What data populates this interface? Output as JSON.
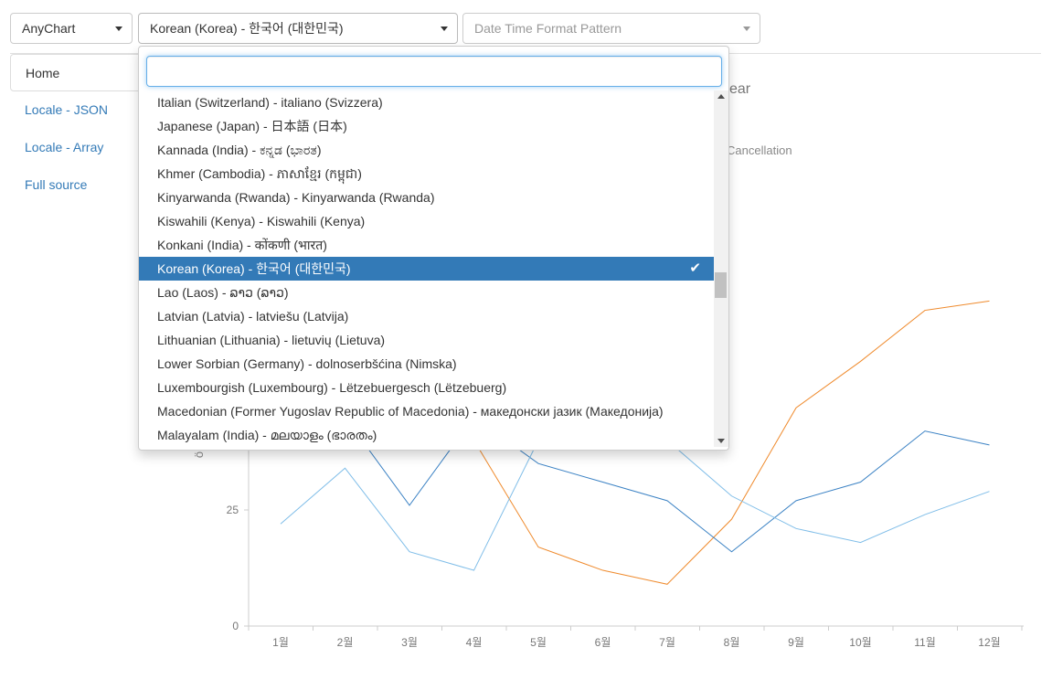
{
  "toolbar": {
    "library_select": "AnyChart",
    "locale_select": "Korean (Korea) - 한국어 (대한민국)",
    "format_placeholder": "Date Time Format Pattern"
  },
  "sidebar": {
    "items": [
      {
        "label": "Home",
        "active": true
      },
      {
        "label": "Locale - JSON"
      },
      {
        "label": "Locale - Array"
      },
      {
        "label": "Full source"
      }
    ]
  },
  "chart_fragments": {
    "title_tail": "ear",
    "legend_tail": "Cancellation",
    "ylabel_tail": "ö"
  },
  "dropdown": {
    "search_value": "",
    "items": [
      "Italian (Switzerland) - italiano (Svizzera)",
      "Japanese (Japan) - 日本語 (日本)",
      "Kannada (India) - ಕನ್ನಡ (ಭಾರತ)",
      "Khmer (Cambodia) - ភាសាខ្មែរ (កម្ពុជា)",
      "Kinyarwanda (Rwanda) - Kinyarwanda (Rwanda)",
      "Kiswahili (Kenya) - Kiswahili (Kenya)",
      "Konkani (India) - कोंकणी (भारत)",
      "Korean (Korea) - 한국어 (대한민국)",
      "Lao (Laos) - ລາວ (ລາວ)",
      "Latvian (Latvia) - latviešu (Latvija)",
      "Lithuanian (Lithuania) - lietuvių (Lietuva)",
      "Lower Sorbian (Germany) - dolnoserbšćina (Nimska)",
      "Luxembourgish (Luxembourg) - Lëtzebuergesch (Lëtzebuerg)",
      "Macedonian (Former Yugoslav Republic of Macedonia) - македонски јазик (Македонија)",
      "Malayalam (India) - മലയാളം (ഭാരതം)"
    ],
    "selected_index": 7,
    "check_icon": "check-icon"
  },
  "colors": {
    "accent": "#337ab7",
    "series_orange": "#ef8a2c",
    "series_blue": "#3b82c4",
    "series_lightblue": "#7fbde8"
  },
  "chart_data": {
    "type": "line",
    "categories": [
      "1월",
      "2월",
      "3월",
      "4월",
      "5월",
      "6월",
      "7월",
      "8월",
      "9월",
      "10월",
      "11월",
      "12월"
    ],
    "y_ticks": [
      0,
      25
    ],
    "ylim": [
      0,
      80
    ],
    "series": [
      {
        "color": "#ef8a2c",
        "values": [
          null,
          null,
          null,
          40,
          17,
          12,
          9,
          23,
          47,
          57,
          68,
          70
        ]
      },
      {
        "color": "#3b82c4",
        "values": [
          null,
          45,
          26,
          45,
          35,
          31,
          27,
          16,
          27,
          31,
          42,
          39
        ]
      },
      {
        "color": "#7fbde8",
        "values": [
          22,
          34,
          16,
          12,
          40,
          40,
          40,
          28,
          21,
          18,
          24,
          29
        ]
      }
    ]
  }
}
